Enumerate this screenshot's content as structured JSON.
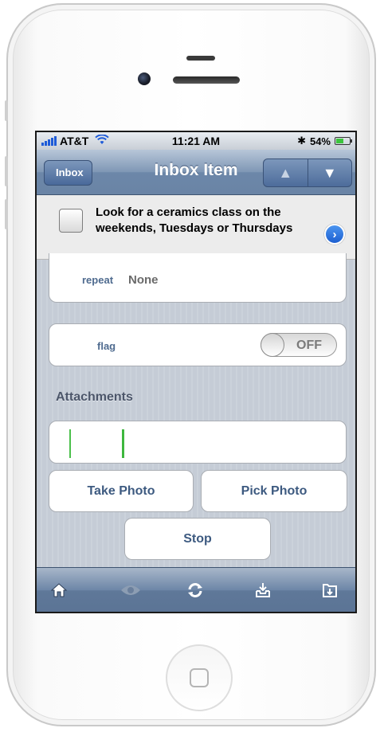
{
  "status": {
    "carrier": "AT&T",
    "time": "11:21 AM",
    "battery": "54%",
    "battery_level": 0.54
  },
  "nav": {
    "back_label": "Inbox",
    "title": "Inbox Item",
    "prev_icon": "up-arrow-icon",
    "next_icon": "down-arrow-icon"
  },
  "task": {
    "title": "Look for a ceramics class on the weekends, Tuesdays or Thursdays",
    "completed": false
  },
  "fields": {
    "repeat_label": "repeat",
    "repeat_value": "None",
    "flag_label": "flag",
    "flag_state": "OFF"
  },
  "attachments": {
    "header": "Attachments",
    "take_photo": "Take Photo",
    "pick_photo": "Pick Photo",
    "stop": "Stop"
  },
  "toolbar": {
    "items": [
      "home-icon",
      "eye-icon",
      "sync-icon",
      "inbox-tray-icon",
      "folder-icon"
    ]
  },
  "colors": {
    "nav_blue": "#6c87a9",
    "label_blue": "#4f6b8f",
    "accent_blue": "#1d5fd0",
    "battery_green": "#3cc43c"
  }
}
